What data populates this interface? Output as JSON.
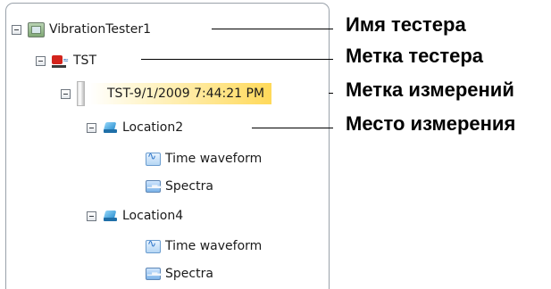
{
  "tree": {
    "tester": {
      "label": "VibrationTester1",
      "icon": "tester-device-icon"
    },
    "tester_label": {
      "label": "TST",
      "icon": "tester-label-icon"
    },
    "measurement": {
      "label": "TST-9/1/2009 7:44:21 PM",
      "icon": "measurement-bar-icon",
      "highlight": "#ffd95a"
    },
    "locations": [
      {
        "label": "Location2",
        "icon": "location-icon",
        "children": [
          {
            "label": "Time waveform",
            "icon": "time-waveform-icon"
          },
          {
            "label": "Spectra",
            "icon": "spectra-icon"
          }
        ]
      },
      {
        "label": "Location4",
        "icon": "location-icon",
        "children": [
          {
            "label": "Time waveform",
            "icon": "time-waveform-icon"
          },
          {
            "label": "Spectra",
            "icon": "spectra-icon"
          }
        ]
      }
    ]
  },
  "annotations": {
    "tester_name": "Имя тестера",
    "tester_label": "Метка тестера",
    "measurement_label": "Метка измерений",
    "measurement_place": "Место измерения"
  }
}
